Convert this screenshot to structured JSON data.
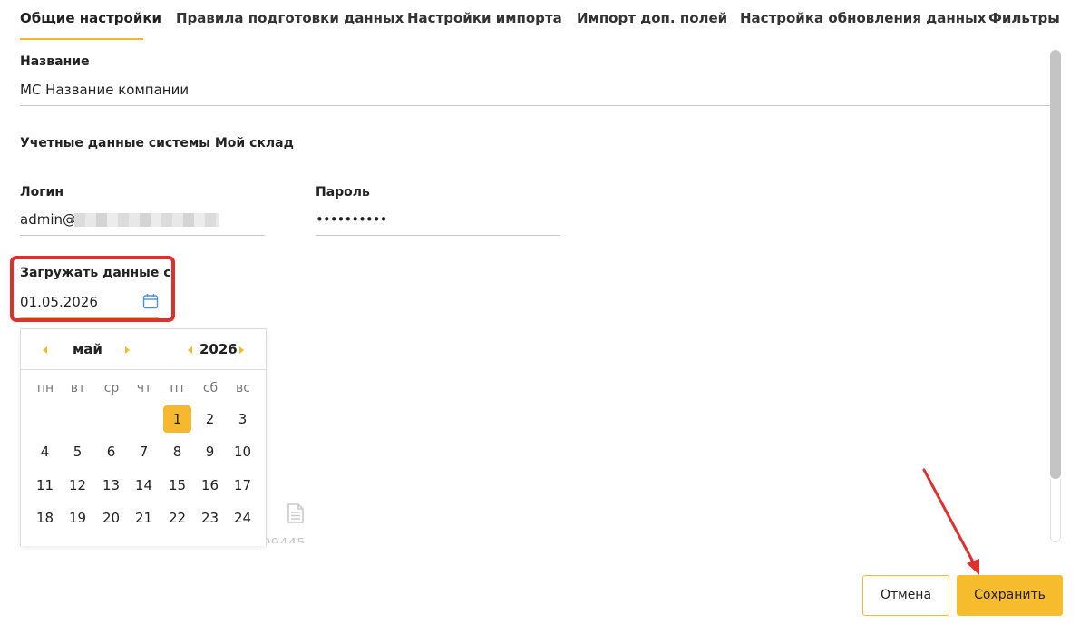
{
  "tabs": [
    {
      "label": "Общие настройки",
      "active": true
    },
    {
      "label": "Правила подготовки данных"
    },
    {
      "label": "Настройки импорта"
    },
    {
      "label": "Импорт доп. полей"
    },
    {
      "label": "Настройка обновления данных"
    },
    {
      "label": "Фильтры"
    }
  ],
  "form": {
    "name_label": "Название",
    "name_value": "МС Название компании",
    "section_title": "Учетные данные системы Мой склад",
    "login_label": "Логин",
    "login_value": "admin@",
    "password_label": "Пароль",
    "password_value": "••••••••••",
    "load_from_label": "Загружать данные с",
    "load_from_value": "01.05.2026"
  },
  "calendar": {
    "month": "май",
    "year": "2026",
    "weekdays": [
      "пн",
      "вт",
      "ср",
      "чт",
      "пт",
      "сб",
      "вс"
    ],
    "weeks": [
      [
        "",
        "",
        "",
        "",
        "1",
        "2",
        "3"
      ],
      [
        "4",
        "5",
        "6",
        "7",
        "8",
        "9",
        "10"
      ],
      [
        "11",
        "12",
        "13",
        "14",
        "15",
        "16",
        "17"
      ],
      [
        "18",
        "19",
        "20",
        "21",
        "22",
        "23",
        "24"
      ]
    ],
    "selected_day": "1"
  },
  "background": {
    "partial_number": "09445"
  },
  "buttons": {
    "cancel": "Отмена",
    "save": "Сохранить"
  },
  "colors": {
    "accent": "#f5b82e",
    "highlight": "#e0302e",
    "calendar_icon": "#4a90e2"
  },
  "icons": [
    "calendar-icon",
    "document-icon",
    "chevron-left-icon",
    "chevron-right-icon"
  ]
}
